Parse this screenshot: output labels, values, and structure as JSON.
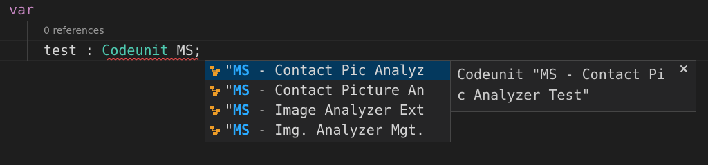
{
  "code": {
    "keyword_var": "var",
    "codelens": "0 references",
    "line2": {
      "ident": "test",
      "colon": " : ",
      "type": "Codeunit",
      "partial": " MS;"
    }
  },
  "suggestions": [
    {
      "quote": "\"",
      "match": "MS",
      "rest": " - Contact Pic Analyz",
      "selected": true
    },
    {
      "quote": "\"",
      "match": "MS",
      "rest": " - Contact Picture An",
      "selected": false
    },
    {
      "quote": "\"",
      "match": "MS",
      "rest": " - Image Analyzer Ext",
      "selected": false
    },
    {
      "quote": "\"",
      "match": "MS",
      "rest": " - Img. Analyzer Mgt.",
      "selected": false
    }
  ],
  "details": {
    "text": "Codeunit \"MS - Contact Pic Analyzer Test\"",
    "close_icon": "close-icon"
  },
  "colors": {
    "background": "#1e1e1e",
    "keyword": "#c586c0",
    "type": "#4ec9b0",
    "match_highlight": "#2aaaff",
    "selected_row": "#04395e",
    "widget_bg": "#252526",
    "icon_orange": "#ee9d28",
    "squiggle": "#f14c4c"
  }
}
